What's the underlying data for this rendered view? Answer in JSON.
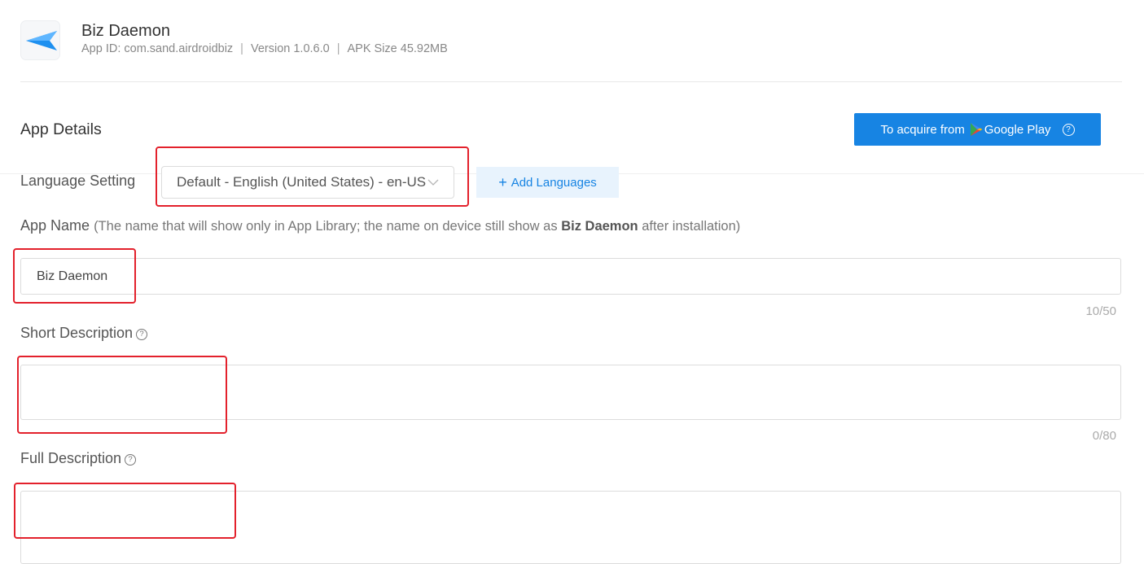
{
  "app": {
    "name": "Biz Daemon",
    "app_id": "App ID: com.sand.airdroidbiz",
    "version": "Version 1.0.6.0",
    "apk_size": "APK Size 45.92MB"
  },
  "details": {
    "title": "App Details",
    "google_play_button": {
      "prefix": "To acquire from",
      "brand": "Google Play",
      "help_icon": "?"
    }
  },
  "language": {
    "label": "Language Setting",
    "selected": "Default - English (United States) - en-US",
    "add_button": "Add Languages"
  },
  "app_name": {
    "label": "App Name",
    "note_prefix": "(The name that will show only in App Library; the name on device still show as ",
    "note_bold": "Biz Daemon",
    "note_suffix": " after installation)",
    "value": "Biz Daemon",
    "count": "10/50"
  },
  "short_description": {
    "label": "Short Description",
    "value": "",
    "count": "0/80"
  },
  "full_description": {
    "label": "Full Description",
    "value": ""
  },
  "colors": {
    "primary": "#1784e3",
    "annotation": "#e3212c"
  }
}
